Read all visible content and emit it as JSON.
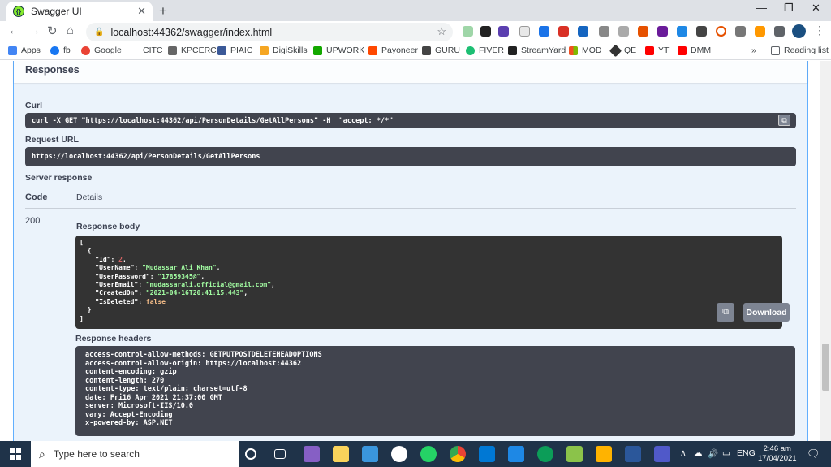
{
  "browser": {
    "tab_title": "Swagger UI",
    "tab_close": "✕",
    "new_tab": "+",
    "url": "localhost:44362/swagger/index.html",
    "bookmarks": [
      {
        "label": "Apps",
        "color": "#4285f4"
      },
      {
        "label": "fb",
        "color": "#1877f2"
      },
      {
        "label": "Google",
        "color": "#ea4335"
      },
      {
        "label": "CITC",
        "color": "#ffffff"
      },
      {
        "label": "KPCERC",
        "color": "#666666"
      },
      {
        "label": "PIAIC",
        "color": "#3b5998"
      },
      {
        "label": "DigiSkills",
        "color": "#f5a623"
      },
      {
        "label": "UPWORK",
        "color": "#14a800"
      },
      {
        "label": "Payoneer",
        "color": "#ff4800"
      },
      {
        "label": "GURU",
        "color": "#444444"
      },
      {
        "label": "FIVER",
        "color": "#1dbf73"
      },
      {
        "label": "StreamYard",
        "color": "#222222"
      },
      {
        "label": "MOD",
        "color": "#f25022"
      },
      {
        "label": "QE",
        "color": "#333333"
      },
      {
        "label": "YT",
        "color": "#ff0000"
      },
      {
        "label": "DMM",
        "color": "#ff0000"
      }
    ],
    "bookmarks_overflow": "»",
    "reading_list": "Reading list"
  },
  "swagger": {
    "responses_heading": "Responses",
    "curl_label": "Curl",
    "curl_command": "curl -X GET \"https://localhost:44362/api/PersonDetails/GetAllPersons\" -H  \"accept: */*\"",
    "request_url_label": "Request URL",
    "request_url": "https://localhost:44362/api/PersonDetails/GetAllPersons",
    "server_response_label": "Server response",
    "code_header": "Code",
    "details_header": "Details",
    "status_code": "200",
    "response_body_label": "Response body",
    "response_body": {
      "open_bracket": "[",
      "open_brace": "  {",
      "id_key": "    \"Id\": ",
      "id_val": "2",
      "username_key": "    \"UserName\": ",
      "username_val": "\"Mudassar Ali Khan\"",
      "password_key": "    \"UserPassword\": ",
      "password_val": "\"17859345@\"",
      "email_key": "    \"UserEmail\": ",
      "email_val": "\"mudassarali.official@gmail.com\"",
      "created_key": "    \"CreatedOn\": ",
      "created_val": "\"2021-04-16T20:41:15.443\"",
      "deleted_key": "    \"IsDeleted\": ",
      "deleted_val": "false",
      "close_brace": "  }",
      "close_bracket": "]"
    },
    "download_label": "Download",
    "response_headers_label": "Response headers",
    "response_headers": [
      "access-control-allow-methods: GETPUTPOSTDELETEHEADOPTIONS",
      "access-control-allow-origin: https://localhost:44362",
      "content-encoding: gzip",
      "content-length: 270",
      "content-type: text/plain; charset=utf-8",
      "date: Fri16 Apr 2021 21:37:00 GMT",
      "server: Microsoft-IIS/10.0",
      "vary: Accept-Encoding",
      "x-powered-by: ASP.NET"
    ]
  },
  "taskbar": {
    "search_placeholder": "Type here to search",
    "language": "ENG",
    "time": "2:46 am",
    "date": "17/04/2021"
  }
}
